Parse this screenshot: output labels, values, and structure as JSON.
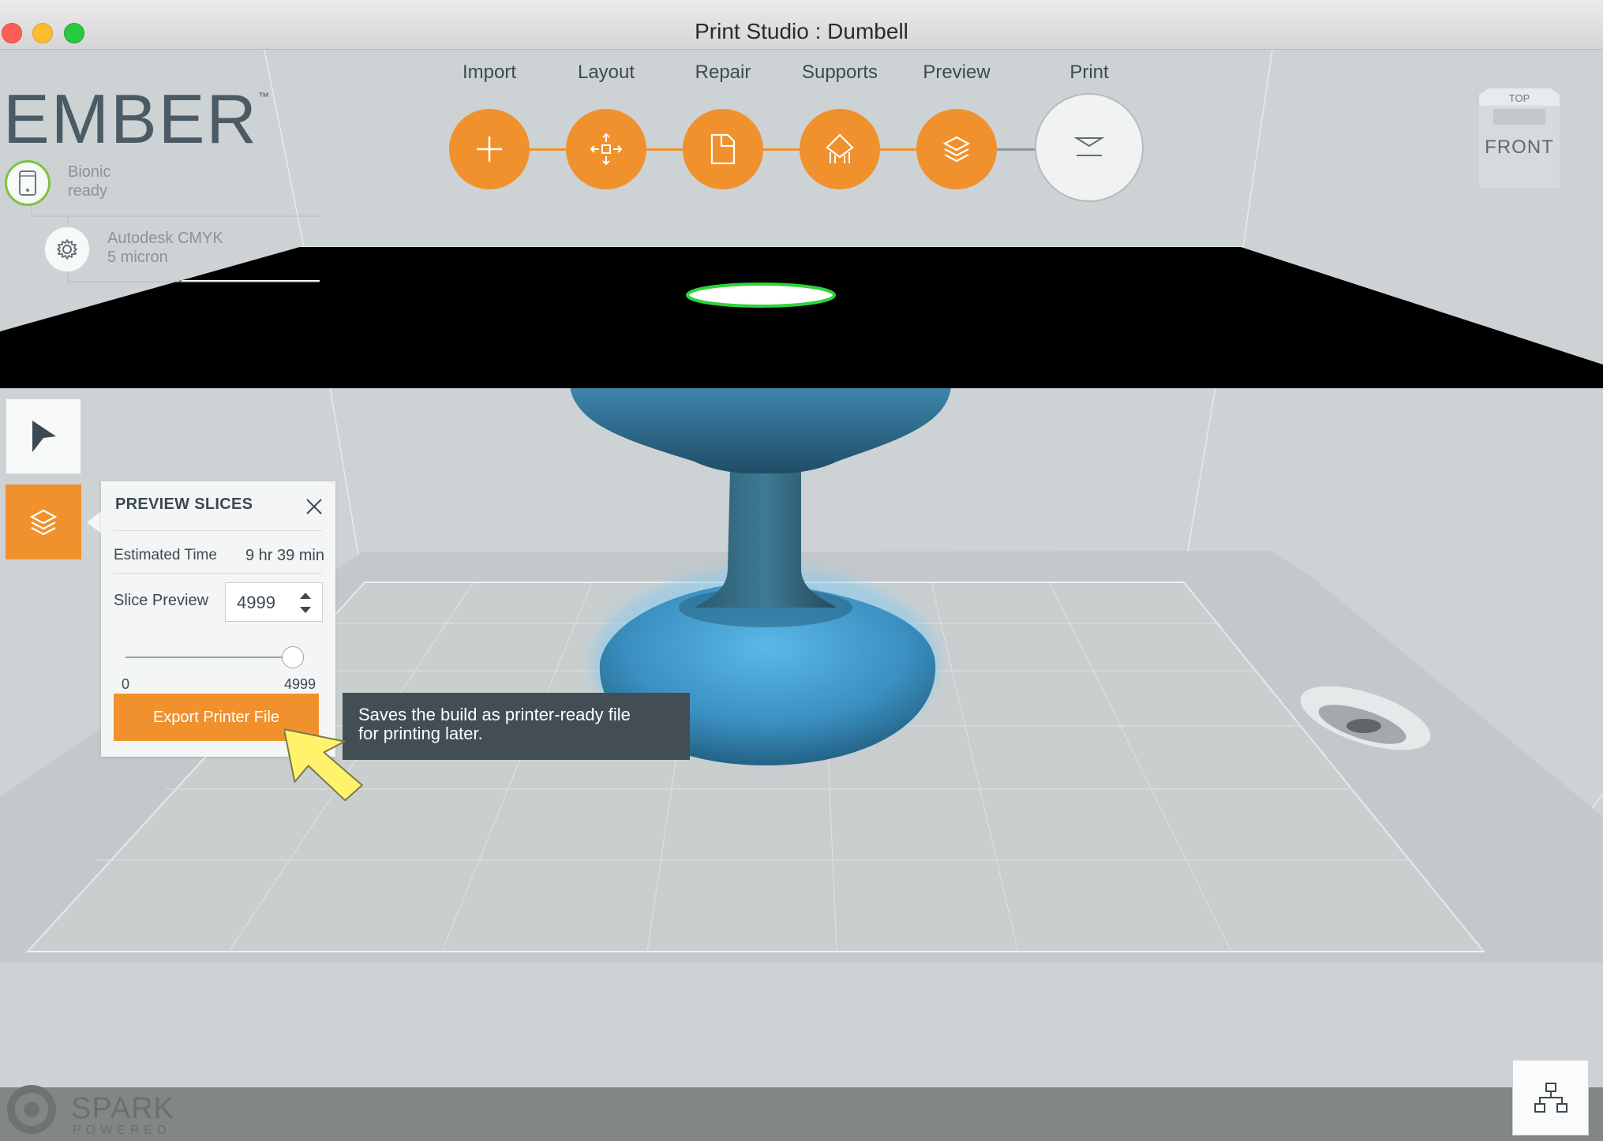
{
  "window": {
    "title": "Print Studio : Dumbell"
  },
  "brand": {
    "name": "EMBER",
    "trademark": "™"
  },
  "printer": {
    "name": "Bionic",
    "status": "ready"
  },
  "material": {
    "name": "Autodesk CMYK",
    "layer": "5 micron"
  },
  "workflow": {
    "steps": [
      {
        "label": "Import",
        "icon": "plus-icon"
      },
      {
        "label": "Layout",
        "icon": "move-arrows-icon"
      },
      {
        "label": "Repair",
        "icon": "repair-page-icon"
      },
      {
        "label": "Supports",
        "icon": "supports-icon"
      },
      {
        "label": "Preview",
        "icon": "layers-icon"
      },
      {
        "label": "Print",
        "icon": "print-tray-icon"
      }
    ]
  },
  "view_cube": {
    "top": "TOP",
    "front": "FRONT"
  },
  "preview_panel": {
    "title": "PREVIEW SLICES",
    "estimated_time_label": "Estimated Time",
    "estimated_time_value": "9 hr 39 min",
    "slice_preview_label": "Slice Preview",
    "slice_value": "4999",
    "slider_min": "0",
    "slider_max": "4999",
    "slider_fraction": 1.0,
    "export_label": "Export Printer File"
  },
  "tooltip": {
    "line1": "Saves the build as printer-ready file",
    "line2": "for printing later."
  },
  "footer": {
    "spark": "SPARK",
    "powered": "POWERED"
  },
  "colors": {
    "accent": "#f0912d",
    "model": "#4aa8dc",
    "panel": "#f4f5f5",
    "tooltip_bg": "#424d54"
  }
}
